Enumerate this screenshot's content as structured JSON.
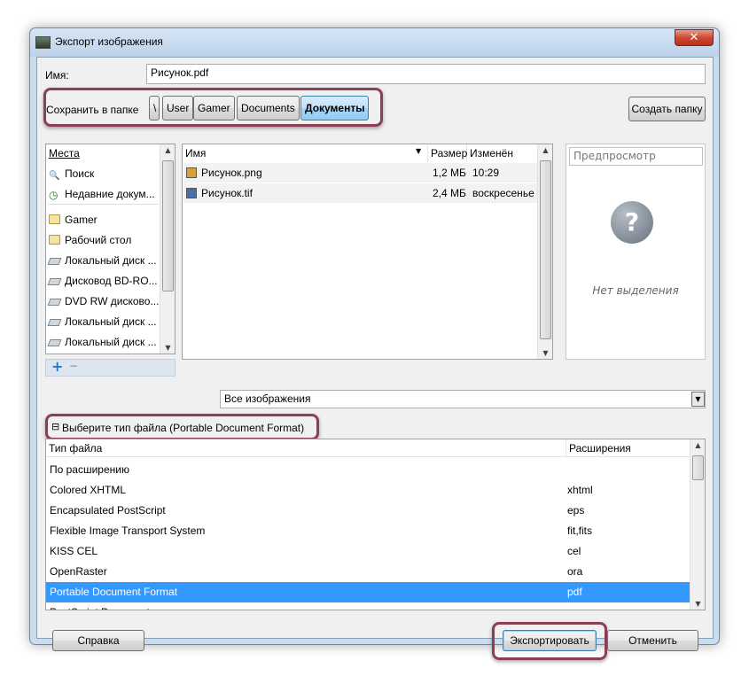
{
  "window": {
    "title": "Экспорт изображения",
    "close": "✕"
  },
  "name_row": {
    "label": "Имя:",
    "value": "Рисунок.pdf"
  },
  "save_in": {
    "label": "Сохранить в папке",
    "path": [
      "\\",
      "User",
      "Gamer",
      "Documents",
      "Документы"
    ],
    "create_folder": "Создать папку"
  },
  "places": {
    "header": "Места",
    "items": [
      {
        "label": "Поиск",
        "icon": "search-icon"
      },
      {
        "label": "Недавние докум...",
        "icon": "recent-icon"
      },
      {
        "label": "Gamer",
        "icon": "folder-icon"
      },
      {
        "label": "Рабочий стол",
        "icon": "folder-icon"
      },
      {
        "label": "Локальный диск ...",
        "icon": "drive-icon"
      },
      {
        "label": "Дисковод BD-RO...",
        "icon": "optical-drive-icon"
      },
      {
        "label": "DVD RW дисково...",
        "icon": "optical-drive-icon"
      },
      {
        "label": "Локальный диск ...",
        "icon": "drive-icon"
      },
      {
        "label": "Локальный диск ...",
        "icon": "drive-icon"
      }
    ],
    "add": "+",
    "remove": "−"
  },
  "files": {
    "columns": {
      "name": "Имя",
      "size": "Размер",
      "modified": "Изменён"
    },
    "rows": [
      {
        "name": "Рисунок.png",
        "size": "1,2 МБ",
        "modified": "10:29"
      },
      {
        "name": "Рисунок.tif",
        "size": "2,4 МБ",
        "modified": "воскресенье"
      }
    ]
  },
  "preview": {
    "label": "Предпросмотр",
    "empty": "Нет выделения"
  },
  "filter": {
    "value": "Все изображения"
  },
  "filetype": {
    "toggle": "⊟",
    "label": "Выберите тип файла (Portable Document Format)",
    "columns": {
      "type": "Тип файла",
      "ext": "Расширения"
    },
    "rows": [
      {
        "type": "По расширению",
        "ext": ""
      },
      {
        "type": "Colored XHTML",
        "ext": "xhtml"
      },
      {
        "type": "Encapsulated PostScript",
        "ext": "eps"
      },
      {
        "type": "Flexible Image Transport System",
        "ext": "fit,fits"
      },
      {
        "type": "KISS CEL",
        "ext": "cel"
      },
      {
        "type": "OpenRaster",
        "ext": "ora"
      },
      {
        "type": "Portable Document Format",
        "ext": "pdf"
      },
      {
        "type": "PostScript Document",
        "ext": "ps"
      }
    ],
    "selected_index": 6
  },
  "buttons": {
    "help": "Справка",
    "export": "Экспортировать",
    "cancel": "Отменить"
  },
  "colors": {
    "accent": "#3399ff",
    "highlight_ring": "#8a3f52"
  }
}
